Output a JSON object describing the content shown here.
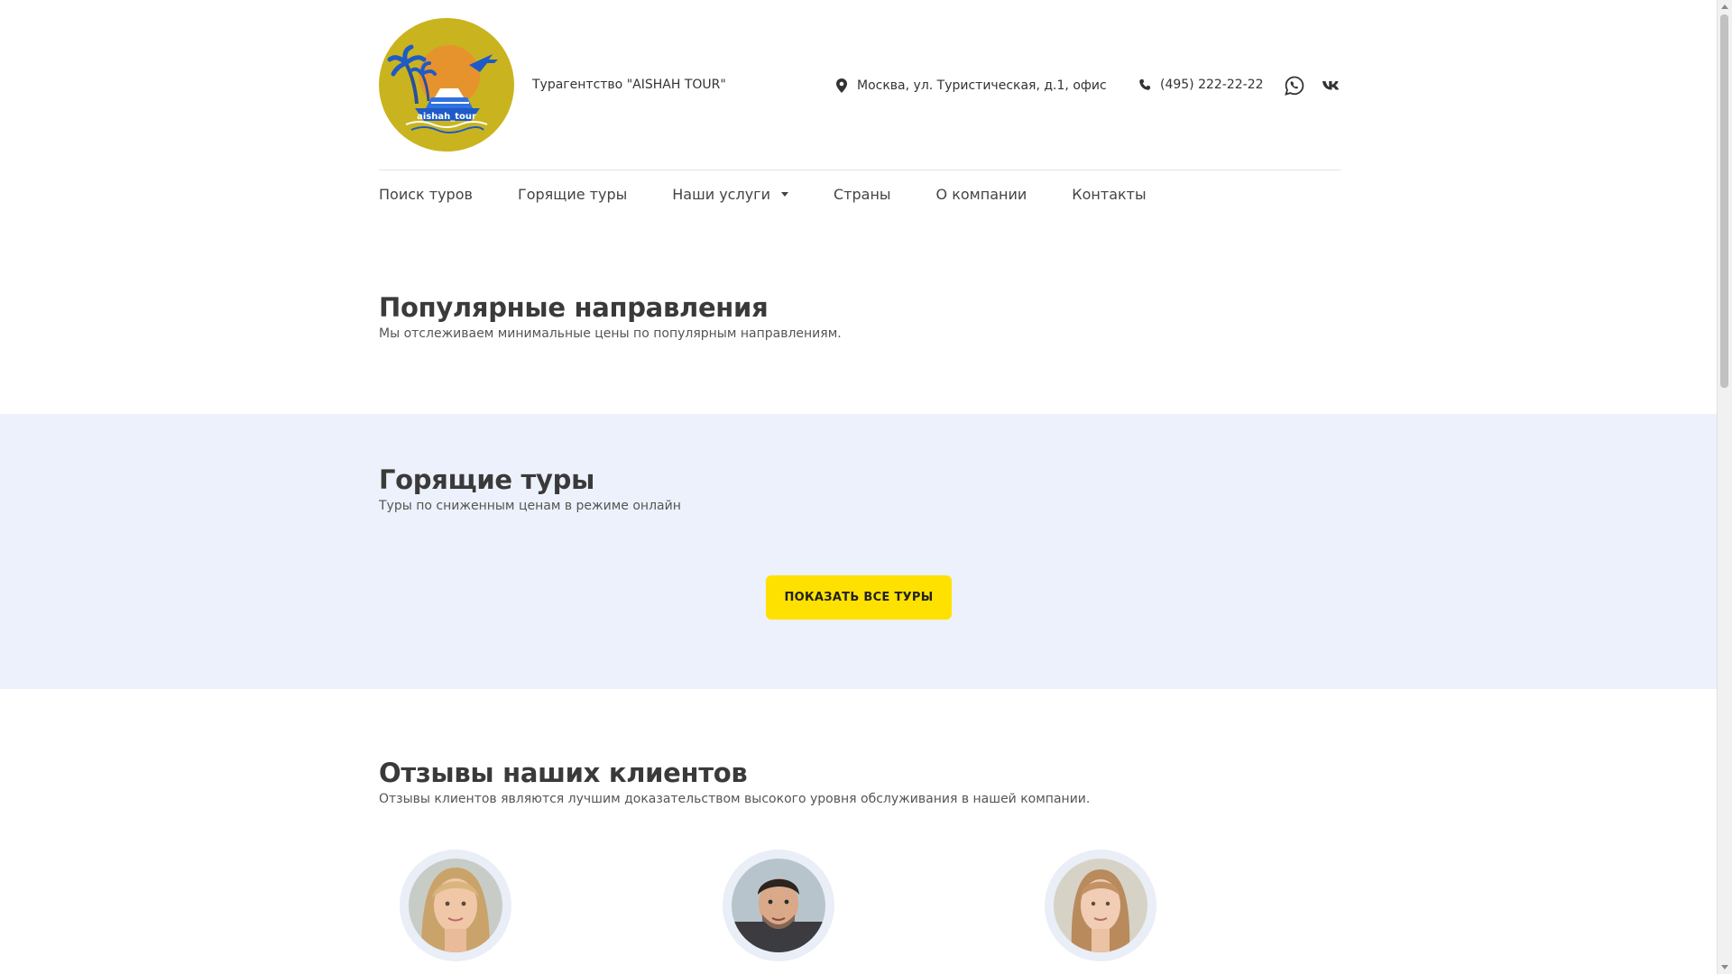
{
  "header": {
    "logo_text": "aishah_tour",
    "brand": "Турагентство \"AISHAH TOUR\"",
    "address": "Москва, ул. Туристическая, д.1, офис",
    "phone": "(495) 222-22-22",
    "social": [
      "whatsapp-icon",
      "vk-icon"
    ]
  },
  "nav": {
    "items": [
      "Поиск туров",
      "Горящие туры",
      "Наши услуги",
      "Страны",
      "О компании",
      "Контакты"
    ]
  },
  "popular": {
    "title": "Популярные направления",
    "subtitle": "Мы отслеживаем минимальные цены по популярным направлениям."
  },
  "hot": {
    "title": "Горящие туры",
    "subtitle": "Туры по сниженным ценам в режиме онлайн",
    "button": "ПОКАЗАТЬ ВСЕ ТУРЫ"
  },
  "reviews": {
    "title": "Отзывы наших клиентов",
    "subtitle": "Отзывы клиентов являются лучшим доказательством высокого уровня обслуживания в нашей компании."
  },
  "colors": {
    "accent": "#ffe100",
    "band": "#ecf1fb",
    "logo_bg": "#c9b41f"
  }
}
